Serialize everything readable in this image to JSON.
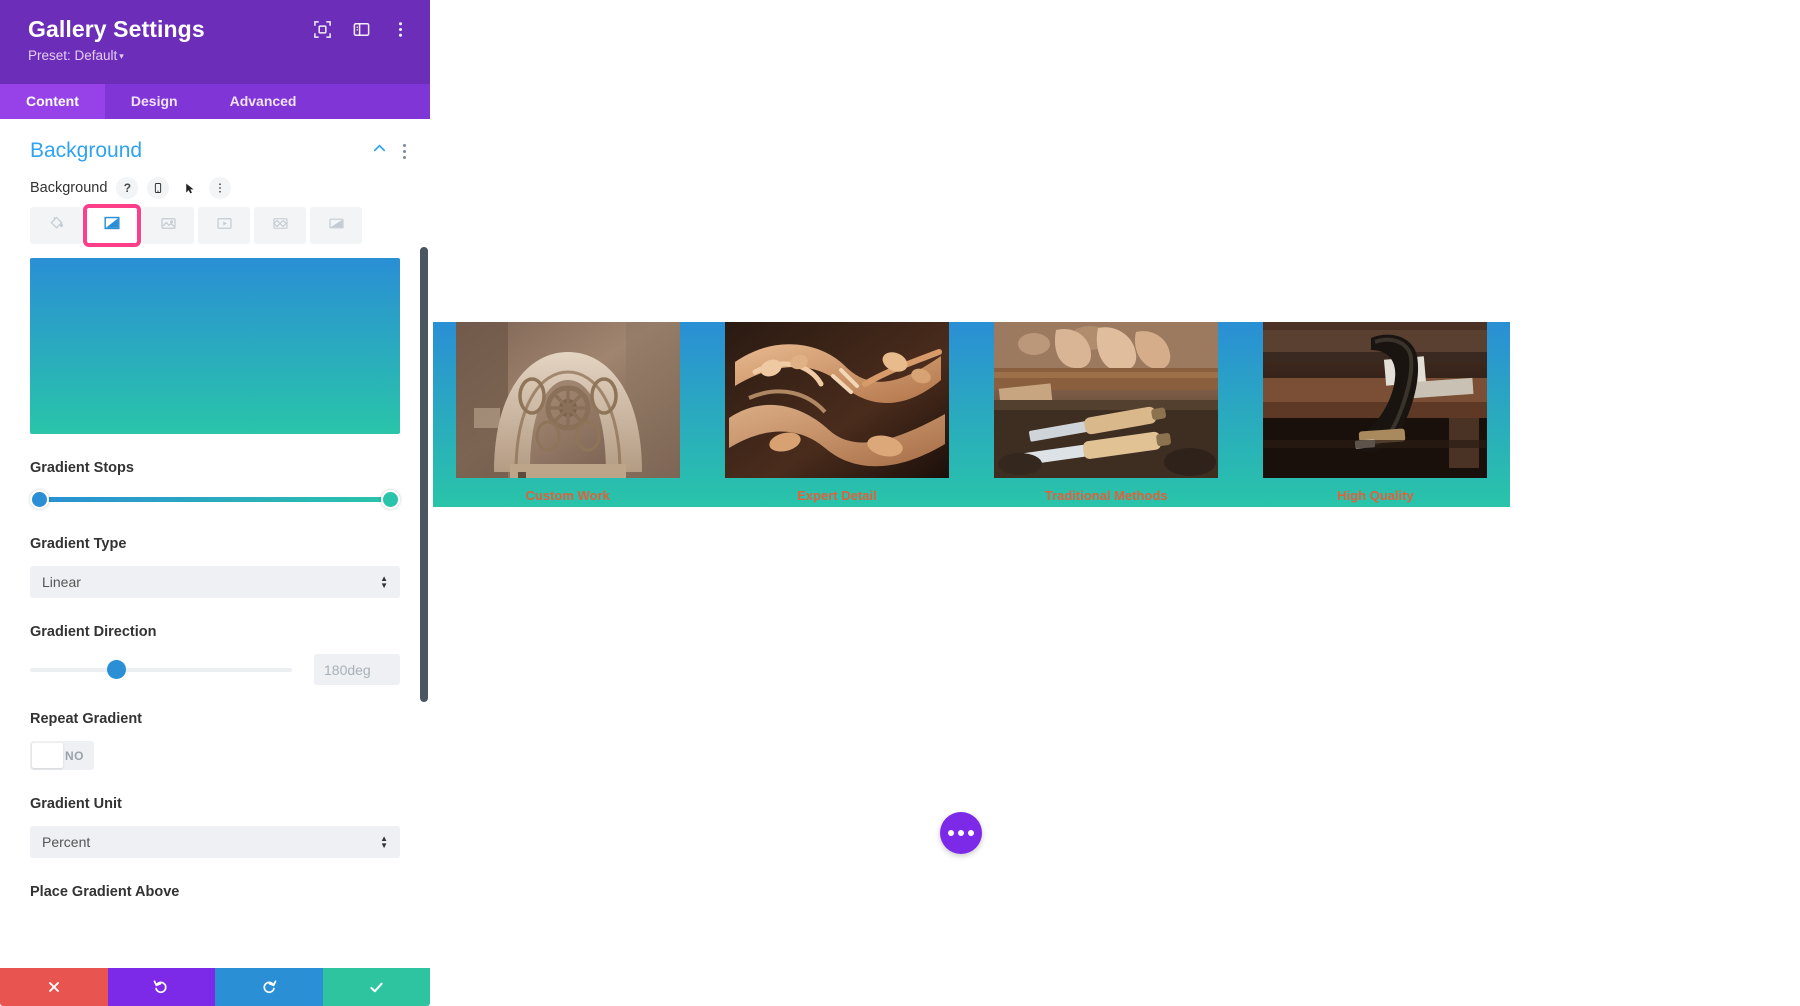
{
  "panel": {
    "title": "Gallery Settings",
    "preset_label": "Preset: Default",
    "preset_caret": "▾",
    "header_icons": [
      {
        "name": "focus-target-icon",
        "label": "Focus"
      },
      {
        "name": "panel-layout-icon",
        "label": "Layout"
      },
      {
        "name": "kebab-menu-icon",
        "label": "More options"
      }
    ],
    "tabs": [
      {
        "label": "Content",
        "active": true
      },
      {
        "label": "Design",
        "active": false
      },
      {
        "label": "Advanced",
        "active": false
      }
    ],
    "section": {
      "title": "Background",
      "collapse_icon": "chevron-up-icon",
      "menu_icon": "kebab-menu-icon"
    },
    "field": {
      "label": "Background",
      "help_glyph": "?",
      "responsive_icon": "mobile-device-icon",
      "hover_icon": "cursor-arrow-icon",
      "more_icon": "kebab-menu-icon"
    },
    "background_types": [
      {
        "name": "background-color-tab",
        "icon": "paint-bucket-icon",
        "selected": false
      },
      {
        "name": "background-gradient-tab",
        "icon": "gradient-icon",
        "selected": true
      },
      {
        "name": "background-image-tab",
        "icon": "image-icon",
        "selected": false
      },
      {
        "name": "background-video-tab",
        "icon": "video-icon",
        "selected": false
      },
      {
        "name": "background-pattern-tab",
        "icon": "pattern-icon",
        "selected": false
      },
      {
        "name": "background-mask-tab",
        "icon": "mask-icon",
        "selected": false
      }
    ],
    "gradient": {
      "start_color": "#2a8fd5",
      "end_color": "#29c4a9",
      "preview_css": "linear-gradient(180deg, #2a8fd5 0%, #29c4a9 100%)",
      "stops_label": "Gradient Stops",
      "start_stop_pct": 0,
      "end_stop_pct": 100,
      "type_label": "Gradient Type",
      "type_value": "Linear",
      "direction_label": "Gradient Direction",
      "direction_value": "180deg",
      "direction_slider_pct": 33,
      "repeat_label": "Repeat Gradient",
      "repeat_value": "NO",
      "unit_label": "Gradient Unit",
      "unit_value": "Percent",
      "place_above_label": "Place Gradient Above"
    },
    "footer_buttons": [
      {
        "name": "discard-changes-button",
        "icon": "close-x-icon",
        "color": "#e8544f"
      },
      {
        "name": "undo-button",
        "icon": "undo-arrow-icon",
        "color": "#7c2ae8"
      },
      {
        "name": "redo-button",
        "icon": "redo-arrow-icon",
        "color": "#2a8fd5"
      },
      {
        "name": "save-changes-button",
        "icon": "checkmark-icon",
        "color": "#2ec4a0"
      }
    ]
  },
  "canvas": {
    "gallery": {
      "background_css": "linear-gradient(180deg, #2a8fd5 0%, #29c4a9 100%)",
      "caption_color": "#e2603a",
      "items": [
        {
          "caption": "Custom Work",
          "image": "carved-wooden-chair-back"
        },
        {
          "caption": "Expert Detail",
          "image": "ornate-wood-carving-closeup"
        },
        {
          "caption": "Traditional Methods",
          "image": "hands-carving-with-chisels"
        },
        {
          "caption": "High Quality",
          "image": "clamp-on-workbench"
        }
      ]
    },
    "fab": {
      "name": "page-settings-fab",
      "icon": "ellipsis-icon",
      "color": "#7c2ae8"
    }
  }
}
